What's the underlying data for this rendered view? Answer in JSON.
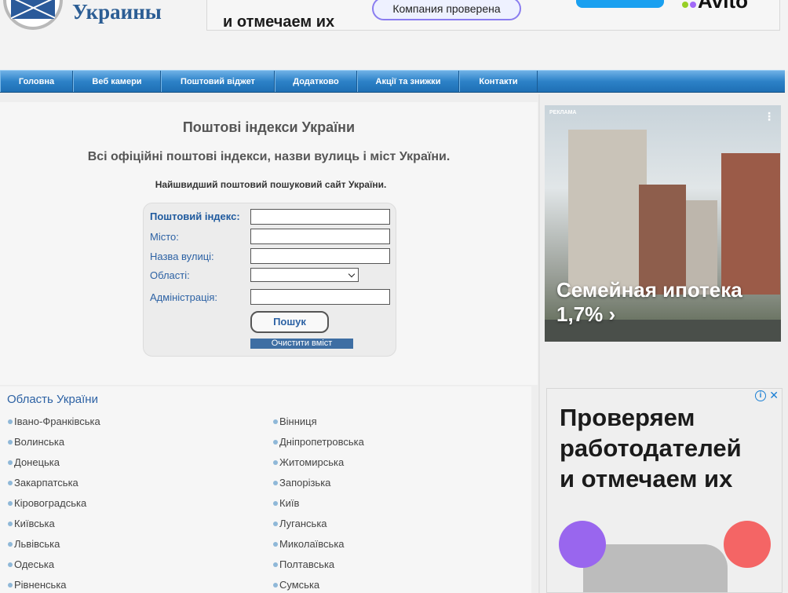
{
  "header": {
    "logo_text": "Украины",
    "top_ad": {
      "headline": "и отмечаем их",
      "pill": "Компания проверена",
      "brand": "Avito"
    }
  },
  "nav": {
    "items": [
      {
        "label": "Головна",
        "width": 93
      },
      {
        "label": "Веб камери",
        "width": 112
      },
      {
        "label": "Поштовий віджет",
        "width": 145
      },
      {
        "label": "Додатково",
        "width": 105
      },
      {
        "label": "Акції та знижки",
        "width": 130
      },
      {
        "label": "Контакти",
        "width": 100
      }
    ]
  },
  "main": {
    "title": "Поштові індекси України",
    "subtitle": "Всі офіційні поштові індекси, назви вулиць і міст України.",
    "tagline": "Найшвидший поштовий пошуковий сайт України.",
    "form": {
      "postal_code_label": "Поштовий індекс:",
      "city_label": "Місто:",
      "street_label": "Назва вулиці:",
      "region_label": "Області:",
      "admin_label": "Адміністрація:",
      "postal_code_value": "",
      "city_value": "",
      "street_value": "",
      "region_value": "",
      "admin_value": "",
      "search_button": "Пошук",
      "clear_button": "Очистити вміст"
    }
  },
  "regions": {
    "title": "Область України",
    "left": [
      "Івано-Франківська",
      "Волинська",
      "Донецька",
      "Закарпатська",
      "Кіровоградська",
      "Київська",
      "Львівська",
      "Одеська",
      "Рівненська"
    ],
    "right": [
      "Вінниця",
      "Дніпропетровська",
      "Житомирська",
      "Запорізька",
      "Київ",
      "Луганська",
      "Миколаївська",
      "Полтавська",
      "Сумська"
    ]
  },
  "ads": {
    "side_top": {
      "label": "РЕКЛАМА",
      "menu": "⋮",
      "line1": "Семейная ипотека",
      "line2": "1,7% ›"
    },
    "side_bottom": {
      "line1": "Проверяем",
      "line2": "работодателей",
      "line3": "и отмечаем их",
      "info": "i",
      "close": "✕"
    }
  },
  "colors": {
    "nav_blue": "#2d82c8",
    "link_blue": "#2d62a4",
    "clear_button": "#3e6ea3"
  }
}
